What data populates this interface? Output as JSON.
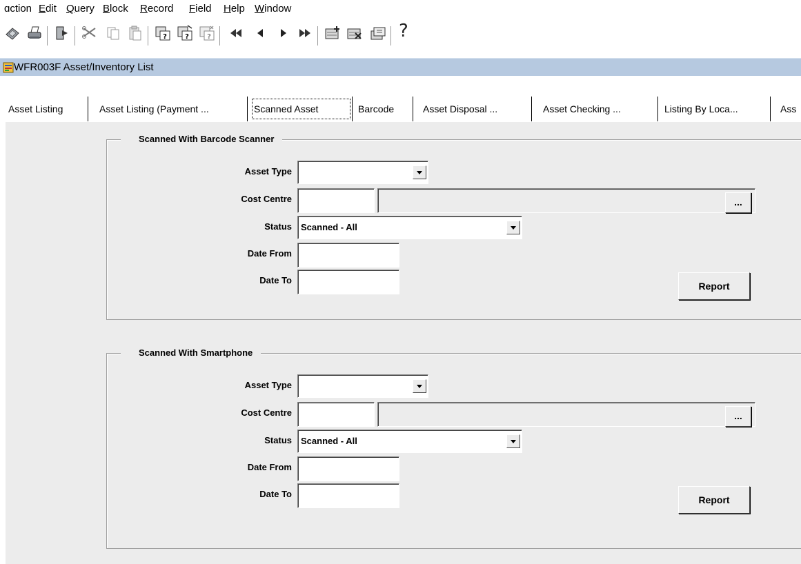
{
  "menu": [
    {
      "pre": "",
      "key": "",
      "post": "ɑction"
    },
    {
      "pre": "",
      "key": "E",
      "post": "dit"
    },
    {
      "pre": "",
      "key": "Q",
      "post": "uery"
    },
    {
      "pre": "",
      "key": "B",
      "post": "lock"
    },
    {
      "pre": "",
      "key": "R",
      "post": "ecord"
    },
    {
      "pre": "",
      "key": "F",
      "post": "ield"
    },
    {
      "pre": "",
      "key": "H",
      "post": "elp"
    },
    {
      "pre": "",
      "key": "W",
      "post": "indow"
    }
  ],
  "toolbar": {
    "icons": [
      "save-icon",
      "print-icon",
      "exit-icon",
      "cut-icon",
      "copy-icon",
      "paste-icon",
      "enter-query-icon",
      "execute-query-icon",
      "cancel-query-icon",
      "first-record-icon",
      "previous-record-icon",
      "next-record-icon",
      "last-record-icon",
      "insert-record-icon",
      "delete-record-icon",
      "duplicate-record-icon",
      "help-icon"
    ],
    "help_glyph": "?"
  },
  "window": {
    "title": "WFR003F Asset/Inventory List"
  },
  "tabs": [
    {
      "label": "Asset Listing"
    },
    {
      "label": "Asset Listing (Payment ..."
    },
    {
      "label": "Scanned Asset"
    },
    {
      "label": "Barcode"
    },
    {
      "label": "Asset Disposal ..."
    },
    {
      "label": "Asset Checking ..."
    },
    {
      "label": "Listing By Loca..."
    },
    {
      "label": "Ass"
    }
  ],
  "active_tab": "Scanned Asset",
  "groups": [
    {
      "title": "Scanned With Barcode Scanner",
      "asset_type_label": "Asset Type",
      "asset_type_value": "",
      "cost_centre_label": "Cost Centre",
      "cost_centre_code": "",
      "cost_centre_desc": "",
      "lov_button": "...",
      "status_label": "Status",
      "status_value": "Scanned - All",
      "date_from_label": "Date From",
      "date_from_value": "",
      "date_to_label": "Date To",
      "date_to_value": "",
      "report_button": "Report"
    },
    {
      "title": "Scanned With Smartphone",
      "asset_type_label": "Asset Type",
      "asset_type_value": "",
      "cost_centre_label": "Cost Centre",
      "cost_centre_code": "",
      "cost_centre_desc": "",
      "lov_button": "...",
      "status_label": "Status",
      "status_value": "Scanned - All",
      "date_from_label": "Date From",
      "date_from_value": "",
      "date_to_label": "Date To",
      "date_to_value": "",
      "report_button": "Report"
    }
  ]
}
